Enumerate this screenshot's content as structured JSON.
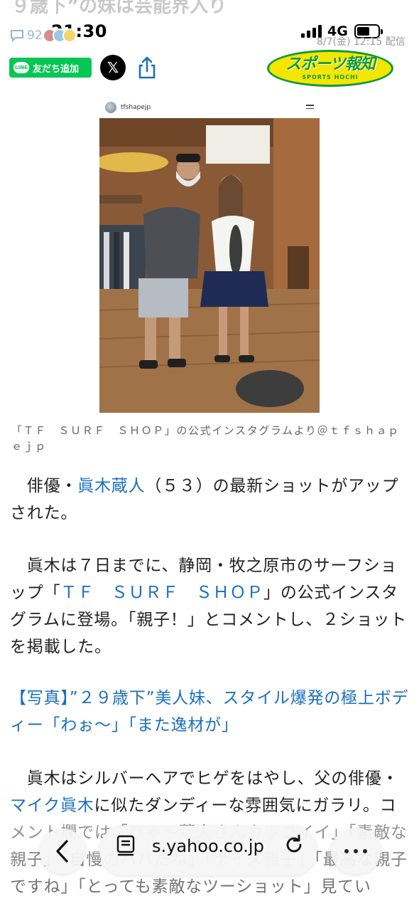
{
  "status_bar": {
    "time": "21:30",
    "network": "4G"
  },
  "header": {
    "faded_title": "９歳下”の妹は芸能界入り",
    "comment_count": "92",
    "date": "8/7(金) 12:15 配信"
  },
  "share": {
    "line_label": "友だち追加",
    "line_badge": "LINE",
    "x_label": "𝕏",
    "logo_text": "スポーツ報知",
    "logo_sub": "SPORTS HOCHI"
  },
  "embed": {
    "username": "tfshapejp"
  },
  "photo_caption": "「ＴＦ　ＳＵＲＦ　ＳＨＯＰ」の公式インスタグラムより＠ｔｆｓｈａｐｅｊｐ",
  "article": {
    "p1": {
      "pre": "　俳優・",
      "link": "眞木蔵人",
      "post": "（５３）の最新ショットがアップされた。"
    },
    "p2": {
      "pre": "　眞木は７日までに、静岡・牧之原市のサーフショップ「",
      "link": "ＴＦ　ＳＵＲＦ　ＳＨＯＰ",
      "post": "」の公式インスタグラムに登場。「親子！」とコメントし、２ショットを掲載した。"
    },
    "p3": "【写真】”２９歳下”美人妹、スタイル爆発の極上ボディー「わぉ～」「また逸材が」",
    "p4": {
      "pre": "　眞木はシルバーヘアでヒゲをはやし、父の俳優・",
      "link": "マイク眞木",
      "post": "に似たダンディーな雰囲気にガラリ。コメント欄では「ひゃ～蔵人さんカッコイイ」「素敵な親子」「自慢のパパだね」「ナイス親子」「最高な親子ですね」「とっても素敵なツーショット」見てい"
    }
  },
  "toolbar": {
    "url": "s.yahoo.co.jp"
  },
  "colors": {
    "link": "#1a6fbd",
    "line_green": "#06c755",
    "logo_yellow": "#f4e600",
    "logo_green": "#0f9a3c"
  },
  "icons": [
    "comment-icon",
    "signal-icon",
    "battery-icon",
    "share-icon",
    "menu-icon",
    "back-chevron-icon",
    "reader-icon",
    "reload-icon",
    "more-icon"
  ]
}
